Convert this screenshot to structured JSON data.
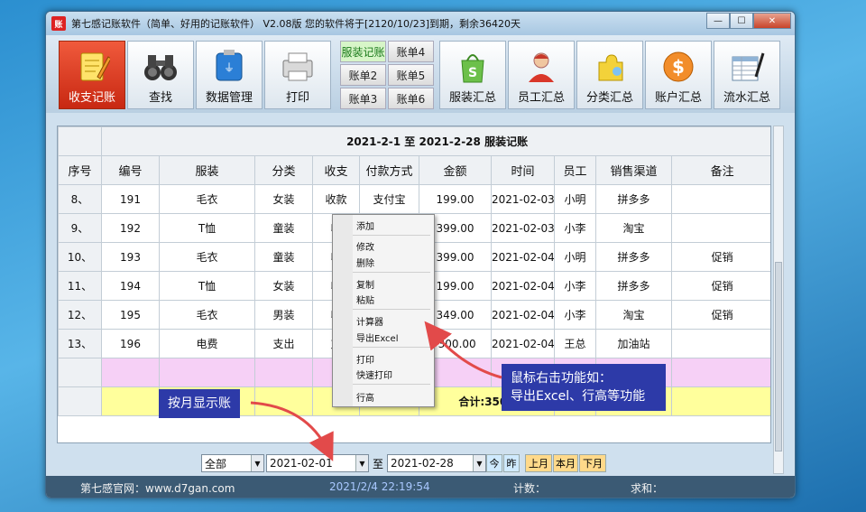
{
  "window": {
    "app_icon": "账",
    "title": "第七感记账软件（简单、好用的记账软件） V2.08版 您的软件将于[2120/10/23]到期，剩余36420天",
    "min_label": "—",
    "max_label": "☐",
    "close_label": "✕"
  },
  "toolbar": {
    "income_expense": "收支记账",
    "search": "查找",
    "data_manage": "数据管理",
    "print": "打印",
    "accounts": [
      "服装记账",
      "账单4",
      "账单2",
      "账单5",
      "账单3",
      "账单6"
    ],
    "clothing_summary": "服装汇总",
    "staff_summary": "员工汇总",
    "category_summary": "分类汇总",
    "account_summary": "账户汇总",
    "journal_summary": "流水汇总"
  },
  "ledger": {
    "title": "2021-2-1  至  2021-2-28  服装记账",
    "headers": [
      "序号",
      "编号",
      "服装",
      "分类",
      "收支",
      "付款方式",
      "金额",
      "时间",
      "员工",
      "销售渠道",
      "备注"
    ],
    "rows": [
      {
        "seq": "8、",
        "no": "191",
        "item": "毛衣",
        "cat": "女装",
        "io": "收款",
        "pay": "支付宝",
        "amount": "199.00",
        "time": "2021-02-03",
        "staff": "小明",
        "channel": "拼多多",
        "note": ""
      },
      {
        "seq": "9、",
        "no": "192",
        "item": "T恤",
        "cat": "童装",
        "io": "收",
        "pay": "",
        "amount": "399.00",
        "time": "2021-02-03",
        "staff": "小李",
        "channel": "淘宝",
        "note": ""
      },
      {
        "seq": "10、",
        "no": "193",
        "item": "毛衣",
        "cat": "童装",
        "io": "收",
        "pay": "",
        "amount": "399.00",
        "time": "2021-02-04",
        "staff": "小明",
        "channel": "拼多多",
        "note": "促销"
      },
      {
        "seq": "11、",
        "no": "194",
        "item": "T恤",
        "cat": "女装",
        "io": "收",
        "pay": "",
        "amount": "199.00",
        "time": "2021-02-04",
        "staff": "小李",
        "channel": "拼多多",
        "note": "促销"
      },
      {
        "seq": "12、",
        "no": "195",
        "item": "毛衣",
        "cat": "男装",
        "io": "收",
        "pay": "",
        "amount": "349.00",
        "time": "2021-02-04",
        "staff": "小李",
        "channel": "淘宝",
        "note": "促销"
      },
      {
        "seq": "13、",
        "no": "196",
        "item": "电费",
        "cat": "支出",
        "io": "支",
        "pay": "",
        "amount": "-300.00",
        "time": "2021-02-04",
        "staff": "王总",
        "channel": "加油站",
        "note": ""
      }
    ],
    "total": "合计:3508"
  },
  "context_menu": [
    "添加",
    "修改",
    "删除",
    "复制",
    "粘贴",
    "计算器",
    "导出Excel",
    "打印",
    "快速打印",
    "行高"
  ],
  "filter": {
    "scope": "全部",
    "start_date": "2021-02-01",
    "to_label": "至",
    "end_date": "2021-02-28",
    "today": "今",
    "yesterday": "昨",
    "last_month": "上月",
    "this_month": "本月",
    "next_month": "下月"
  },
  "statusbar": {
    "website": "第七感官网：www.d7gan.com",
    "datetime": "2021/2/4 22:19:54",
    "count_label": "计数：",
    "sum_label": "求和："
  },
  "callouts": {
    "right_click": "鼠标右击功能如：\n导出Excel、行高等功能",
    "by_month": "按月显示账"
  }
}
